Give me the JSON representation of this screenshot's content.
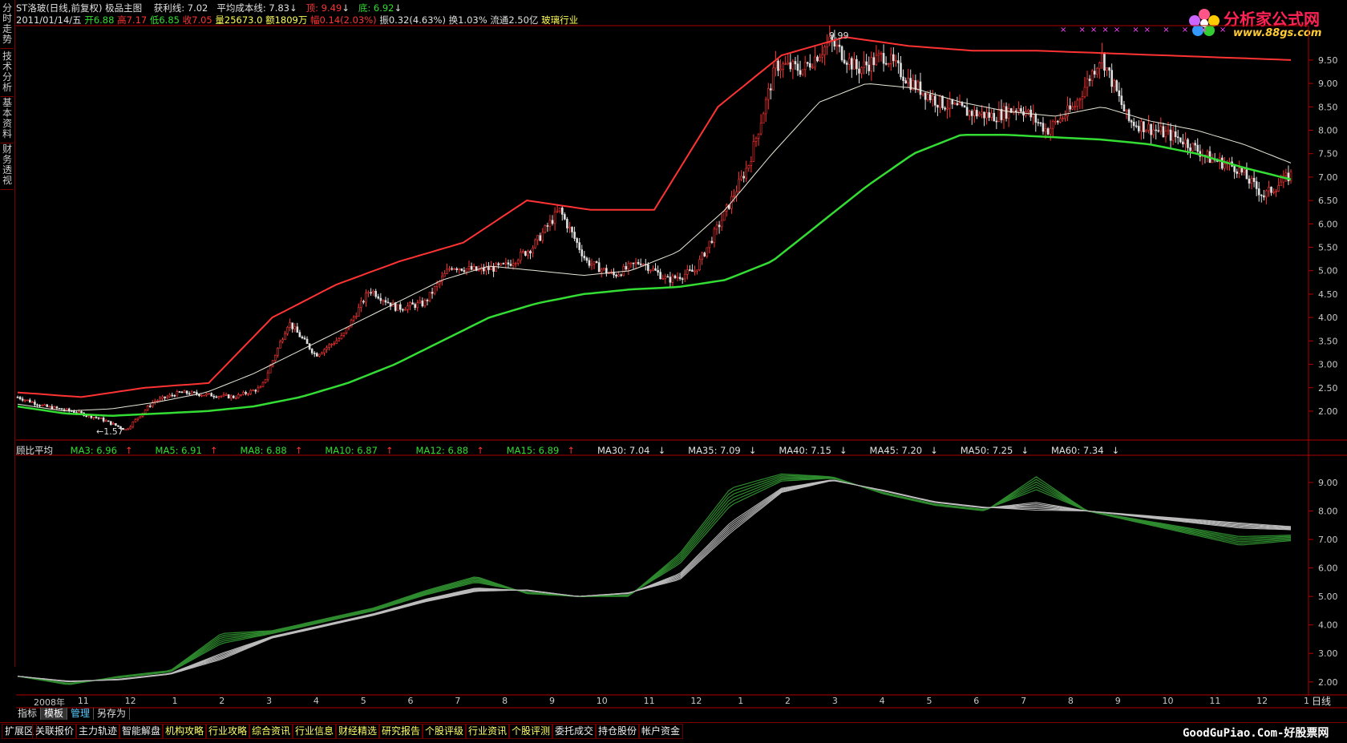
{
  "side_tabs": [
    "分时走势",
    "技术分析",
    "基本资料",
    "财务透视"
  ],
  "header": {
    "title": "ST洛玻(日线,前复权)",
    "indicator": "极品主图",
    "profit_line_label": "获利线:",
    "profit_line_value": "7.02",
    "avg_cost_label": "平均成本线:",
    "avg_cost_value": "7.83",
    "top_label": "顶:",
    "top_value": "9.49",
    "bottom_label": "底:",
    "bottom_value": "6.92"
  },
  "quote": {
    "date": "2011/01/14/五",
    "open_label": "开",
    "open": "6.88",
    "high_label": "高",
    "high": "7.17",
    "low_label": "低",
    "low": "6.85",
    "close_label": "收",
    "close": "7.05",
    "volume_label": "量",
    "volume": "25673.0",
    "amount_label": "额",
    "amount": "1809万",
    "change_label": "幅",
    "change": "0.14(2.03%)",
    "amplitude_label": "振",
    "amplitude": "0.32(4.63%)",
    "turnover_label": "换",
    "turnover": "1.03%",
    "float_label": "流通",
    "float": "2.50亿",
    "industry": "玻璃行业"
  },
  "annotations": {
    "high_mark": "9.99",
    "low_mark": "←1.57"
  },
  "ma_legend": {
    "title": "顾比平均",
    "items": [
      {
        "label": "MA3: 6.96",
        "dir": "↑",
        "color": "#33dd33"
      },
      {
        "label": "MA5: 6.91",
        "dir": "↑",
        "color": "#33dd33"
      },
      {
        "label": "MA8: 6.88",
        "dir": "↑",
        "color": "#33dd33"
      },
      {
        "label": "MA10: 6.87",
        "dir": "↑",
        "color": "#33dd33"
      },
      {
        "label": "MA12: 6.88",
        "dir": "↑",
        "color": "#33dd33"
      },
      {
        "label": "MA15: 6.89",
        "dir": "↑",
        "color": "#33dd33"
      },
      {
        "label": "MA30: 7.04",
        "dir": "↓",
        "color": "#e0e0e0"
      },
      {
        "label": "MA35: 7.09",
        "dir": "↓",
        "color": "#e0e0e0"
      },
      {
        "label": "MA40: 7.15",
        "dir": "↓",
        "color": "#e0e0e0"
      },
      {
        "label": "MA45: 7.20",
        "dir": "↓",
        "color": "#e0e0e0"
      },
      {
        "label": "MA50: 7.25",
        "dir": "↓",
        "color": "#e0e0e0"
      },
      {
        "label": "MA60: 7.34",
        "dir": "↓",
        "color": "#e0e0e0"
      }
    ]
  },
  "logo": {
    "name": "分析家公式网",
    "url": "www.88gs.com"
  },
  "daily_label": "日线",
  "bottom_tabs": [
    "指标",
    "模板",
    "管理",
    "另存为"
  ],
  "bottom_buttons": [
    "扩展区",
    "关联报价",
    "主力轨迹",
    "智能解盘",
    "机构攻略",
    "行业攻略",
    "综合资讯",
    "行业信息",
    "财经精选",
    "研究报告",
    "个股评级",
    "行业资讯",
    "个股评测",
    "委托成交",
    "持仓股份",
    "帐户资金"
  ],
  "watermark": "GoodGuPiao.Com-好股票网",
  "colors": {
    "axis": "#b00000",
    "up": "#ff3333",
    "down": "#e0e0e0",
    "avg_cost": "#33dd33",
    "bg": "#000000"
  },
  "chart_data": [
    {
      "type": "candlestick",
      "title": "",
      "y_ticks": [
        2.0,
        2.5,
        3.0,
        3.5,
        4.0,
        4.5,
        5.0,
        5.5,
        6.0,
        6.5,
        7.0,
        7.5,
        8.0,
        8.5,
        9.0,
        9.5
      ],
      "ylim": [
        1.4,
        10.2
      ],
      "x_labels": [
        "2008年",
        "11",
        "12",
        "1",
        "2",
        "3",
        "4",
        "5",
        "6",
        "7",
        "8",
        "9",
        "10",
        "11",
        "12",
        "1",
        "2",
        "3",
        "4",
        "5",
        "6",
        "7",
        "8",
        "9",
        "10",
        "11",
        "12",
        "1"
      ],
      "price_path": [
        2.3,
        2.1,
        2.0,
        1.85,
        1.6,
        2.2,
        2.4,
        2.35,
        2.3,
        2.5,
        3.9,
        3.2,
        3.6,
        4.6,
        4.2,
        4.3,
        5.1,
        5.0,
        5.1,
        5.5,
        6.3,
        5.2,
        4.9,
        5.2,
        4.8,
        5.0,
        6.1,
        7.3,
        9.4,
        9.3,
        9.9,
        9.3,
        9.6,
        9.0,
        8.6,
        8.4,
        8.3,
        8.5,
        8.0,
        8.5,
        9.6,
        8.2,
        8.0,
        7.8,
        7.4,
        7.2,
        6.6,
        7.05
      ],
      "series": [
        {
          "values": [
            2.1,
            1.95,
            1.9,
            1.95,
            2.0,
            2.1,
            2.3,
            2.6,
            3.0,
            3.5,
            4.0,
            4.3,
            4.5,
            4.6,
            4.65,
            4.8,
            5.2,
            6.0,
            6.8,
            7.5,
            7.9,
            7.9,
            7.85,
            7.8,
            7.7,
            7.5,
            7.2,
            6.95
          ]
        },
        {
          "values": [
            2.15,
            2.0,
            2.05,
            2.2,
            2.4,
            2.8,
            3.3,
            3.8,
            4.3,
            4.8,
            5.1,
            5.0,
            4.9,
            5.0,
            5.4,
            6.3,
            7.5,
            8.6,
            9.0,
            8.9,
            8.6,
            8.4,
            8.3,
            8.5,
            8.2,
            8.0,
            7.7,
            7.3
          ]
        },
        {
          "values": [
            2.4,
            2.3,
            2.5,
            2.6,
            4.0,
            4.7,
            5.2,
            5.6,
            6.5,
            6.3,
            6.3,
            8.5,
            9.6,
            9.99,
            9.8,
            9.7,
            9.7,
            9.65,
            9.6,
            9.55,
            9.5
          ]
        }
      ]
    },
    {
      "type": "line",
      "title": "顾比平均",
      "y_ticks": [
        2.0,
        3.0,
        4.0,
        5.0,
        6.0,
        7.0,
        8.0,
        9.0
      ],
      "ylim": [
        1.6,
        9.9
      ],
      "series": [
        {
          "name": "MA3",
          "values": [
            2.2,
            1.9,
            2.2,
            2.4,
            3.7,
            3.8,
            4.2,
            4.6,
            5.2,
            5.7,
            5.1,
            5.0,
            5.0,
            6.5,
            8.8,
            9.3,
            9.2,
            8.6,
            8.2,
            8.0,
            9.2,
            8.0,
            7.6,
            7.2,
            6.8,
            6.96
          ]
        },
        {
          "name": "MA60",
          "values": [
            2.2,
            2.0,
            2.1,
            2.3,
            3.0,
            3.6,
            4.0,
            4.4,
            4.9,
            5.3,
            5.2,
            5.0,
            5.1,
            5.8,
            7.6,
            8.8,
            9.1,
            8.7,
            8.3,
            8.1,
            8.3,
            8.0,
            7.8,
            7.6,
            7.4,
            7.34
          ]
        }
      ]
    }
  ]
}
